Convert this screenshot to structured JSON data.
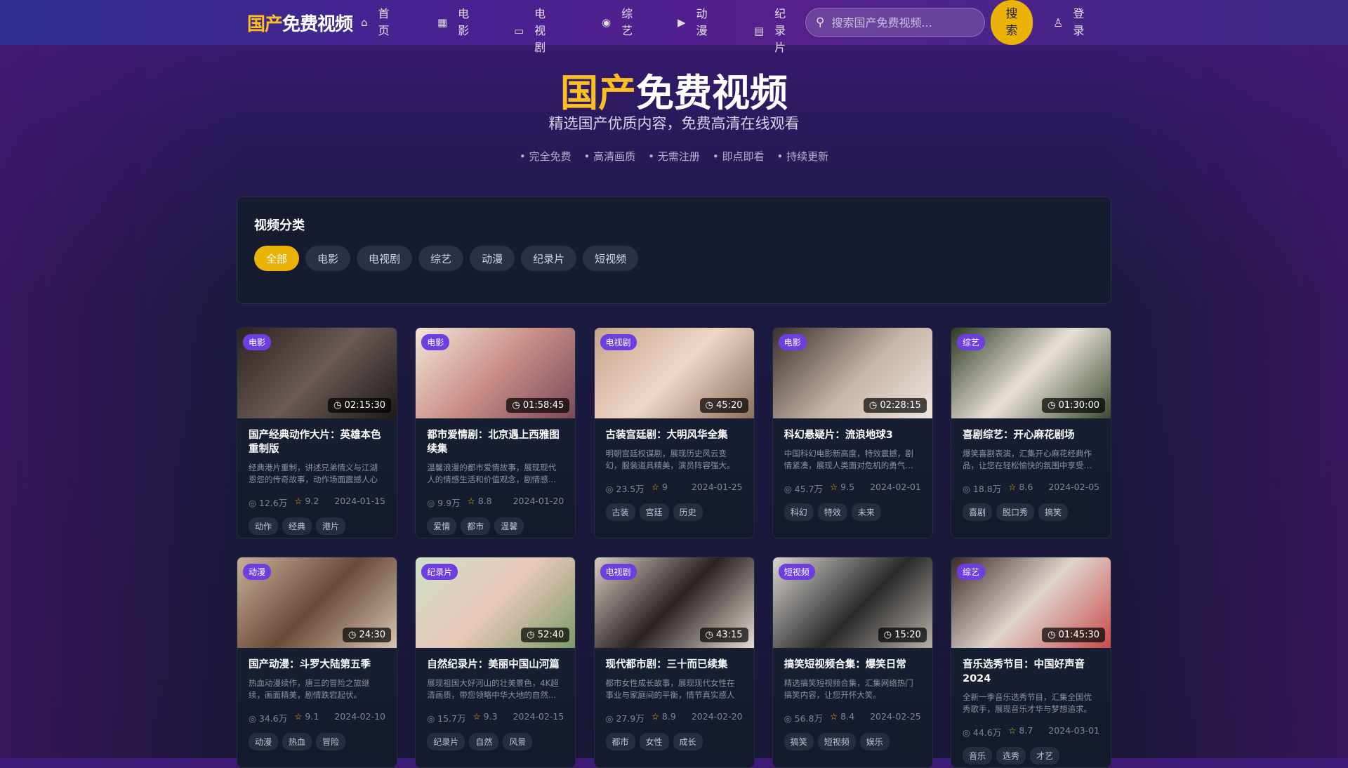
{
  "header": {
    "logo_a": "国产",
    "logo_b": "免费视频",
    "nav": [
      {
        "icon": "home-icon",
        "glyph": "⌂",
        "label": "首页"
      },
      {
        "icon": "film-icon",
        "glyph": "▦",
        "label": "电影"
      },
      {
        "icon": "tv-icon",
        "glyph": "▭",
        "label": "电视剧"
      },
      {
        "icon": "gamepad-icon",
        "glyph": "◉",
        "label": "综艺"
      },
      {
        "icon": "video-icon",
        "glyph": "▶",
        "label": "动漫"
      },
      {
        "icon": "document-icon",
        "glyph": "▤",
        "label": "纪录片"
      }
    ],
    "search_placeholder": "搜索国产免费视频...",
    "search_button": "搜索",
    "login": "登录"
  },
  "hero": {
    "title_a": "国产",
    "title_b": "免费视频",
    "subtitle": "精选国产优质内容，免费高清在线观看",
    "features": [
      "完全免费",
      "高清画质",
      "无需注册",
      "即点即看",
      "持续更新"
    ]
  },
  "categories": {
    "title": "视频分类",
    "items": [
      "全部",
      "电影",
      "电视剧",
      "综艺",
      "动漫",
      "纪录片",
      "短视频"
    ],
    "active": 0
  },
  "colors": {
    "accent": "#eab308",
    "badge": "#6d3ee0"
  },
  "videos": [
    {
      "category": "电影",
      "duration": "02:15:30",
      "title": "国产经典动作大片：英雄本色重制版",
      "desc": "经典港片重制，讲述兄弟情义与江湖恩怨的传奇故事，动作场面震撼人心",
      "views": "12.6万",
      "rating": "9.2",
      "date": "2024-01-15",
      "tags": [
        "动作",
        "经典",
        "港片"
      ]
    },
    {
      "category": "电影",
      "duration": "01:58:45",
      "title": "都市爱情剧：北京遇上西雅图续集",
      "desc": "温馨浪漫的都市爱情故事，展现现代人的情感生活和价值观念，剧情感人至深",
      "views": "9.9万",
      "rating": "8.8",
      "date": "2024-01-20",
      "tags": [
        "爱情",
        "都市",
        "温馨"
      ]
    },
    {
      "category": "电视剧",
      "duration": "45:20",
      "title": "古装宫廷剧：大明风华全集",
      "desc": "明朝宫廷权谋剧，展现历史风云变幻，服装道具精美，演员阵容强大。",
      "views": "23.5万",
      "rating": "9",
      "date": "2024-01-25",
      "tags": [
        "古装",
        "宫廷",
        "历史"
      ]
    },
    {
      "category": "电影",
      "duration": "02:28:15",
      "title": "科幻悬疑片：流浪地球3",
      "desc": "中国科幻电影新高度，特效震撼，剧情紧凑，展现人类面对危机的勇气与智慧",
      "views": "45.7万",
      "rating": "9.5",
      "date": "2024-02-01",
      "tags": [
        "科幻",
        "特效",
        "未来"
      ]
    },
    {
      "category": "综艺",
      "duration": "01:30:00",
      "title": "喜剧综艺：开心麻花剧场",
      "desc": "爆笑喜剧表演，汇集开心麻花经典作品，让您在轻松愉快的氛围中享受欢乐",
      "views": "18.8万",
      "rating": "8.6",
      "date": "2024-02-05",
      "tags": [
        "喜剧",
        "脱口秀",
        "搞笑"
      ]
    },
    {
      "category": "动漫",
      "duration": "24:30",
      "title": "国产动漫：斗罗大陆第五季",
      "desc": "热血动漫续作，唐三的冒险之旅继续，画面精美，剧情跌宕起伏。",
      "views": "34.6万",
      "rating": "9.1",
      "date": "2024-02-10",
      "tags": [
        "动漫",
        "热血",
        "冒险"
      ]
    },
    {
      "category": "纪录片",
      "duration": "52:40",
      "title": "自然纪录片：美丽中国山河篇",
      "desc": "展现祖国大好河山的壮美景色，4K超清画质，带您领略中华大地的自然之美",
      "views": "15.7万",
      "rating": "9.3",
      "date": "2024-02-15",
      "tags": [
        "纪录片",
        "自然",
        "风景"
      ]
    },
    {
      "category": "电视剧",
      "duration": "43:15",
      "title": "现代都市剧：三十而已续集",
      "desc": "都市女性成长故事，展现现代女性在事业与家庭间的平衡，情节真实感人",
      "views": "27.9万",
      "rating": "8.9",
      "date": "2024-02-20",
      "tags": [
        "都市",
        "女性",
        "成长"
      ]
    },
    {
      "category": "短视频",
      "duration": "15:20",
      "title": "搞笑短视频合集：爆笑日常",
      "desc": "精选搞笑短视频合集，汇集网络热门搞笑内容，让您开怀大笑。",
      "views": "56.8万",
      "rating": "8.4",
      "date": "2024-02-25",
      "tags": [
        "搞笑",
        "短视频",
        "娱乐"
      ]
    },
    {
      "category": "综艺",
      "duration": "01:45:30",
      "title": "音乐选秀节目：中国好声音2024",
      "desc": "全新一季音乐选秀节目，汇集全国优秀歌手，展现音乐才华与梦想追求。",
      "views": "44.6万",
      "rating": "8.7",
      "date": "2024-03-01",
      "tags": [
        "音乐",
        "选秀",
        "才艺"
      ]
    }
  ]
}
